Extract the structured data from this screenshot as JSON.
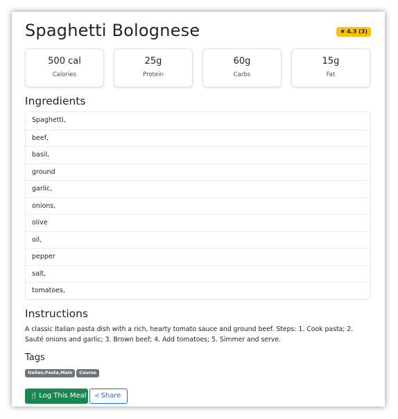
{
  "recipe": {
    "title": "Spaghetti Bolognese",
    "rating_label": "4.3 (3)"
  },
  "nutrients": [
    {
      "value": "500 cal",
      "label": "Calories"
    },
    {
      "value": "25g",
      "label": "Protein"
    },
    {
      "value": "60g",
      "label": "Carbs"
    },
    {
      "value": "15g",
      "label": "Fat"
    }
  ],
  "sections": {
    "ingredients": "Ingredients",
    "instructions": "Instructions",
    "tags": "Tags"
  },
  "ingredients": [
    "Spaghetti,",
    "beef,",
    "basil,",
    "ground",
    "garlic,",
    "onions,",
    "olive",
    "oil,",
    "pepper",
    "salt,",
    "tomatoes,"
  ],
  "instructions": "A classic Italian pasta dish with a rich, hearty tomato sauce and ground beef. Steps: 1. Cook pasta; 2. Sauté onions and garlic; 3. Brown beef; 4. Add tomatoes; 5. Simmer and serve.",
  "tags": [
    "Italian,Pasta,Main",
    "Course"
  ],
  "actions": {
    "log_label": "Log This Meal",
    "share_label": "Share"
  },
  "icons": {
    "rating": "star-icon",
    "log": "utensils-icon",
    "share": "share-icon"
  },
  "colors": {
    "rating_badge": "#ffc107",
    "tag_badge": "#6c757d",
    "log_button": "#198754",
    "share_button": "#0d6efd"
  }
}
